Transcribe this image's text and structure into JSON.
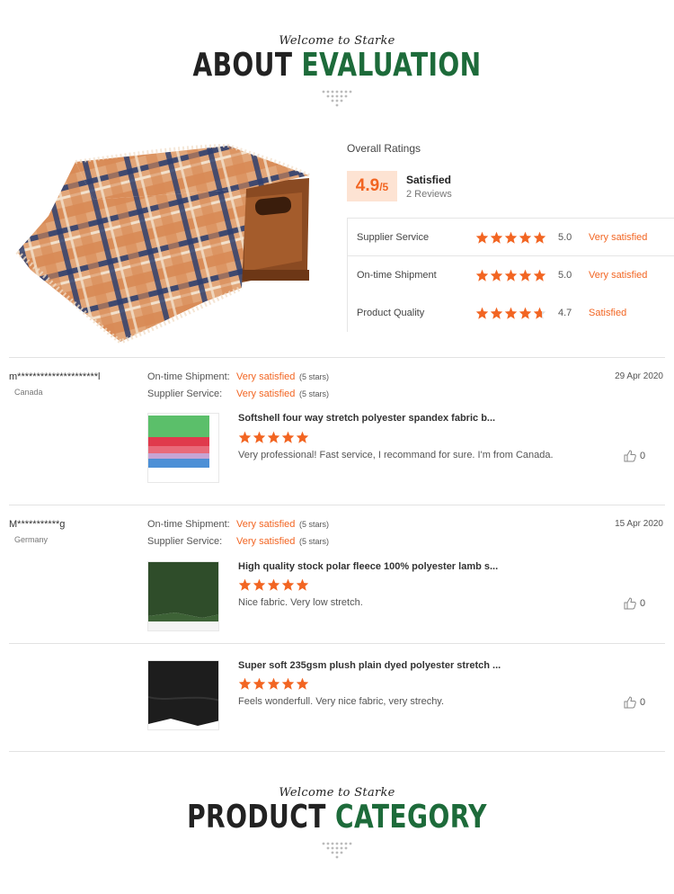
{
  "evaluation_header": {
    "welcome": "Welcome to Starke",
    "title_part1": "ABOUT",
    "title_part2": "EVALUATION"
  },
  "ratings": {
    "overall_label": "Overall Ratings",
    "score": "4.9",
    "score_max": "/5",
    "summary_word": "Satisfied",
    "review_count": "2 Reviews",
    "breakdown": [
      {
        "name": "Supplier Service",
        "stars": 5,
        "value": "5.0",
        "word": "Very satisfied"
      },
      {
        "name": "On-time Shipment",
        "stars": 5,
        "value": "5.0",
        "word": "Very satisfied"
      },
      {
        "name": "Product Quality",
        "stars": 4.7,
        "value": "4.7",
        "word": "Satisfied"
      }
    ]
  },
  "reviews": [
    {
      "reviewer": "m*********************l",
      "country": "Canada",
      "date": "29 Apr 2020",
      "shipment_label": "On-time Shipment:",
      "shipment_value": "Very satisfied",
      "shipment_stars": "(5 stars)",
      "service_label": "Supplier Service:",
      "service_value": "Very satisfied",
      "service_stars": "(5 stars)",
      "product_title": "Softshell four way stretch polyester spandex fabric b...",
      "rating": 5,
      "comment": "Very professional! Fast service, I recommand for sure. I'm from Canada.",
      "likes": "0"
    },
    {
      "reviewer": "M***********g",
      "country": "Germany",
      "date": "15 Apr 2020",
      "shipment_label": "On-time Shipment:",
      "shipment_value": "Very satisfied",
      "shipment_stars": "(5 stars)",
      "service_label": "Supplier Service:",
      "service_value": "Very satisfied",
      "service_stars": "(5 stars)",
      "product_title": "High quality stock polar fleece 100% polyester lamb s...",
      "rating": 5,
      "comment": "Nice fabric. Very low stretch.",
      "likes": "0"
    },
    {
      "product_title": "Super soft 235gsm plush plain dyed polyester stretch ...",
      "rating": 5,
      "comment": "Feels wonderfull. Very nice fabric, very strechy.",
      "likes": "0"
    }
  ],
  "category_header": {
    "welcome": "Welcome to Starke",
    "title_part1": "PRODUCT",
    "title_part2": "CATEGORY"
  },
  "colors": {
    "accent_orange": "#f26522",
    "title_green": "#1d6b3a"
  }
}
